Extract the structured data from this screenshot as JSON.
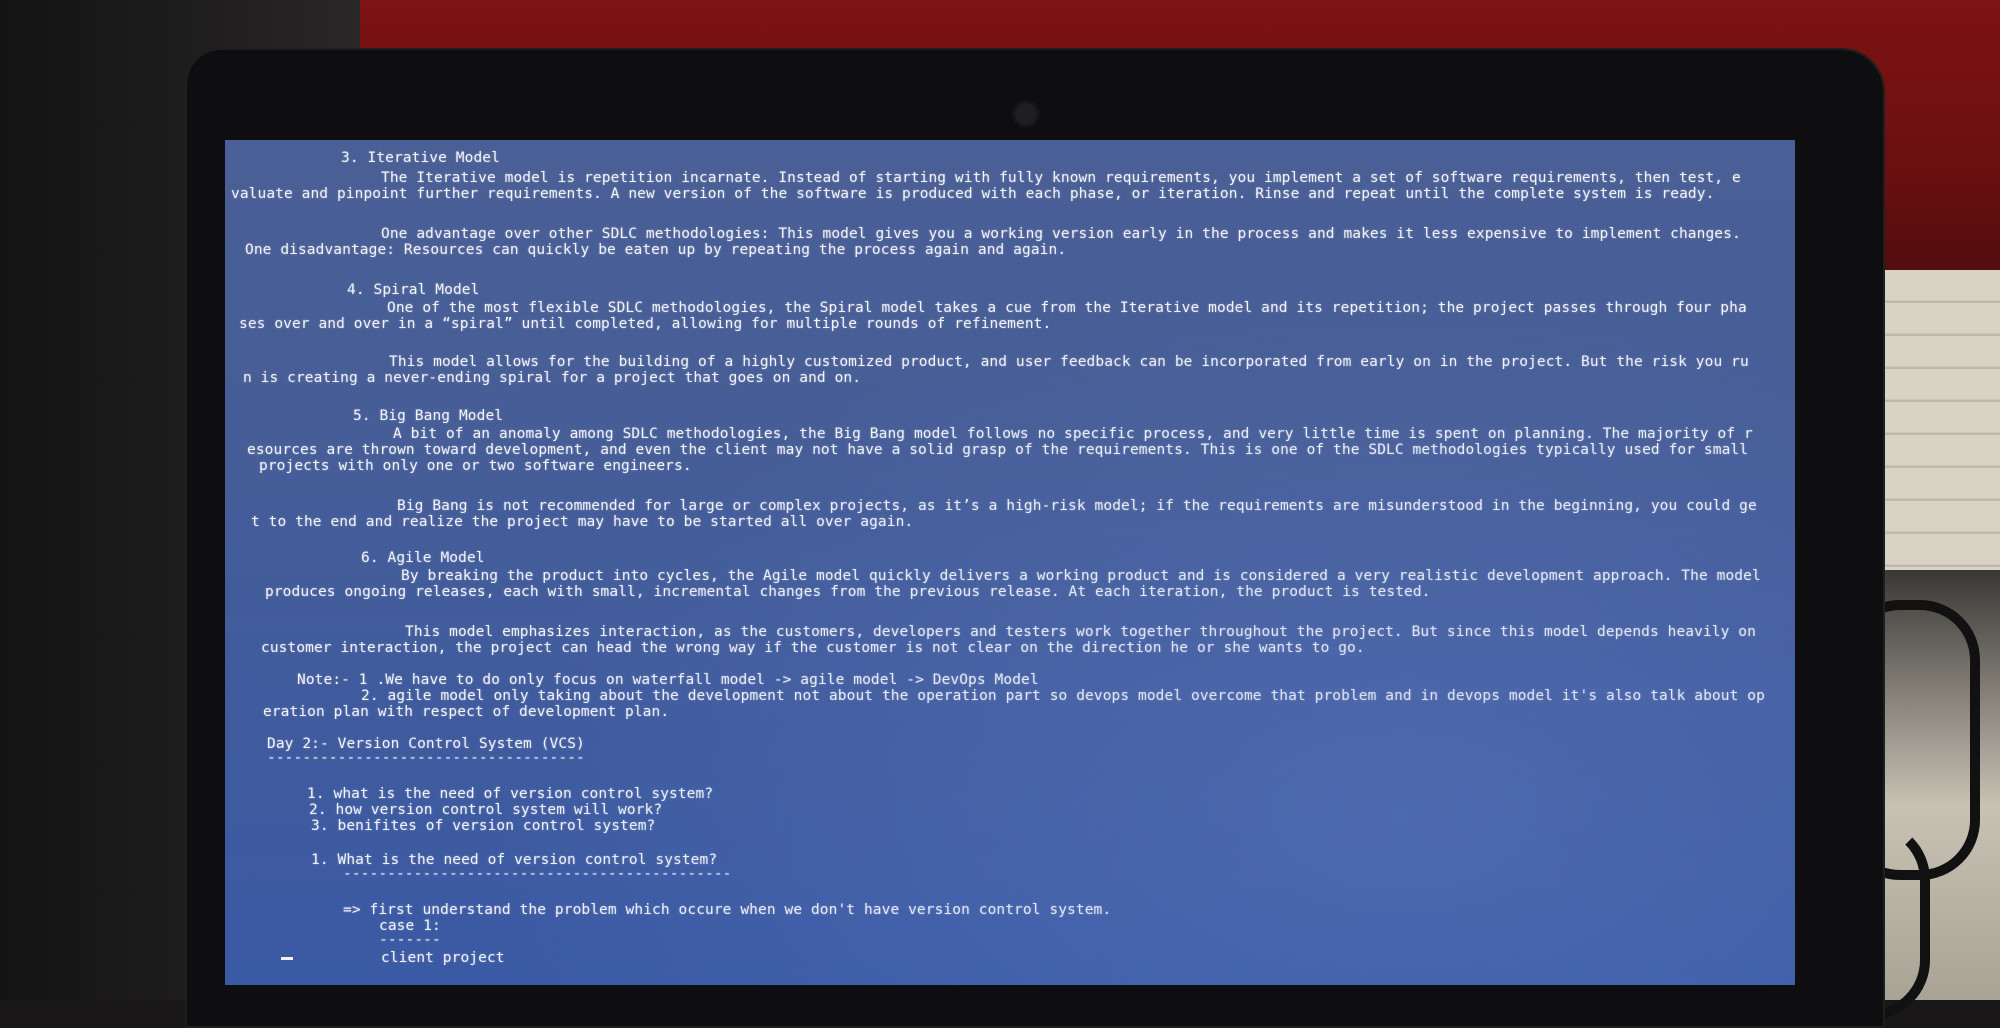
{
  "terminal": {
    "lines": [
      "3. Iterative Model",
      "The Iterative model is repetition incarnate. Instead of starting with fully known requirements, you implement a set of software requirements, then test, e",
      "valuate and pinpoint further requirements. A new version of the software is produced with each phase, or iteration. Rinse and repeat until the complete system is ready.",
      "One advantage over other SDLC methodologies: This model gives you a working version early in the process and makes it less expensive to implement changes.",
      "One disadvantage: Resources can quickly be eaten up by repeating the process again and again.",
      "4. Spiral Model",
      "One of the most flexible SDLC methodologies, the Spiral model takes a cue from the Iterative model and its repetition; the project passes through four pha",
      "ses over and over in a “spiral” until completed, allowing for multiple rounds of refinement.",
      "This model allows for the building of a highly customized product, and user feedback can be incorporated from early on in the project. But the risk you ru",
      "n is creating a never-ending spiral for a project that goes on and on.",
      "5. Big Bang Model",
      "A bit of an anomaly among SDLC methodologies, the Big Bang model follows no specific process, and very little time is spent on planning. The majority of r",
      "esources are thrown toward development, and even the client may not have a solid grasp of the requirements. This is one of the SDLC methodologies typically used for small",
      "projects with only one or two software engineers.",
      "Big Bang is not recommended for large or complex projects, as it’s a high-risk model; if the requirements are misunderstood in the beginning, you could ge",
      "t to the end and realize the project may have to be started all over again.",
      "6. Agile Model",
      "By breaking the product into cycles, the Agile model quickly delivers a working product and is considered a very realistic development approach. The model",
      "produces ongoing releases, each with small, incremental changes from the previous release. At each iteration, the product is tested.",
      "This model emphasizes interaction, as the customers, developers and testers work together throughout the project. But since this model depends heavily on",
      "customer interaction, the project can head the wrong way if the customer is not clear on the direction he or she wants to go.",
      "Note:- 1 .We have to do only focus on waterfall model -> agile model -> DevOps Model",
      "2. agile model only taking about the development not about the operation part so devops model overcome that problem and in devops model it's also talk about op",
      "eration plan with respect of development plan.",
      "Day 2:- Version Control System (VCS)",
      "------------------------------------",
      "1. what is the need of version control system?",
      "2. how version control system will work?",
      "3. benifites of version control system?",
      "1. What is the need of version control system?",
      "--------------------------------------------",
      "=> first understand the problem which occure when we don't have version control system.",
      "case 1:",
      "-------",
      "client project"
    ]
  }
}
